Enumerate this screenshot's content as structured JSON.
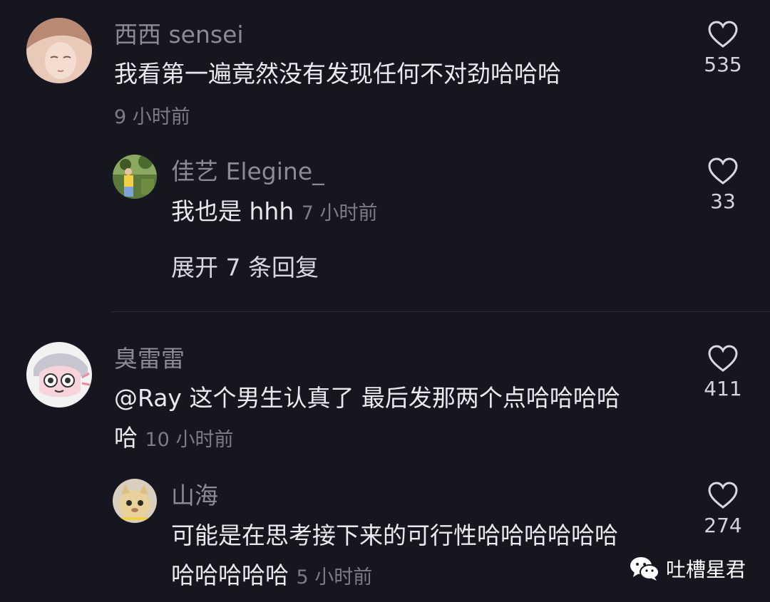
{
  "comments": [
    {
      "username": "西西 sensei",
      "text": "我看第一遍竟然没有发现任何不对劲哈哈哈",
      "time": "9 小时前",
      "likes": "535",
      "replies": [
        {
          "username": "佳艺 Elegine_",
          "text": "我也是 hhh",
          "time": "7 小时前",
          "likes": "33"
        }
      ],
      "expand_label": "展开 7 条回复"
    },
    {
      "username": "臭雷雷",
      "text_line1": "@Ray 这个男生认真了 最后发那两个点哈哈哈哈",
      "text_line2": "哈",
      "time": "10 小时前",
      "likes": "411",
      "replies": [
        {
          "username": "山海",
          "text_line1": "可能是在思考接下来的可行性哈哈哈哈哈哈",
          "text_line2": "哈哈哈哈哈",
          "time": "5 小时前",
          "likes": "274"
        }
      ]
    }
  ],
  "watermark": {
    "icon": "wechat-icon",
    "label": "吐槽星君"
  },
  "colors": {
    "background": "#161620",
    "username": "#8b8b92",
    "text": "#e9e9ee",
    "time": "#7c7c84"
  }
}
